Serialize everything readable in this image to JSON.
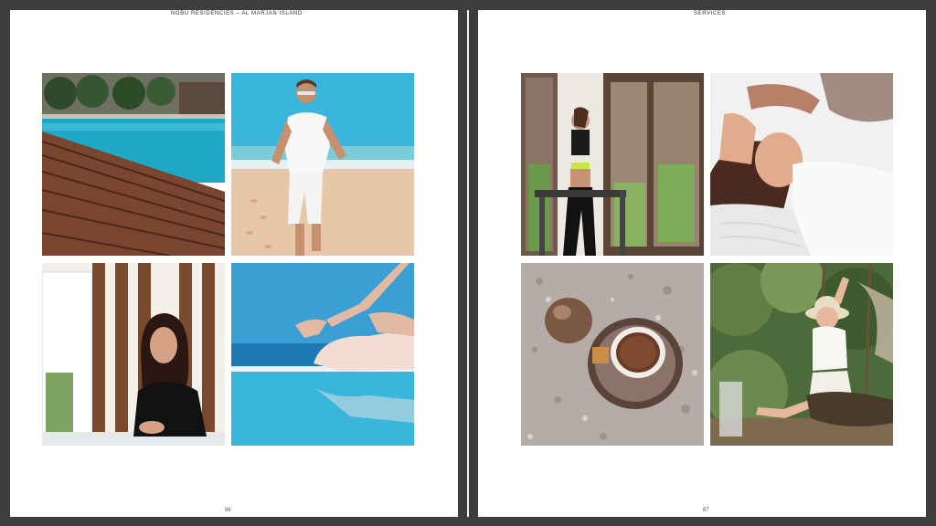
{
  "spread": {
    "left_page": {
      "header": "NOBU RESIDENCIES – AL MARJAN ISLAND",
      "page_number": "86",
      "photos": [
        "pool-deck-photo",
        "beach-runner-photo",
        "woman-portrait-photo",
        "yoga-pose-photo"
      ]
    },
    "right_page": {
      "header": "SERVICES",
      "page_number": "87",
      "photos": [
        "treadmill-gym-photo",
        "spa-massage-photo",
        "coffee-cup-photo",
        "child-swing-photo"
      ]
    }
  },
  "colors": {
    "frame": "#3d3d3d",
    "paper": "#ffffff",
    "pool": "#1fa9c7",
    "sea": "#3ab6dd",
    "wood": "#7b4630"
  }
}
